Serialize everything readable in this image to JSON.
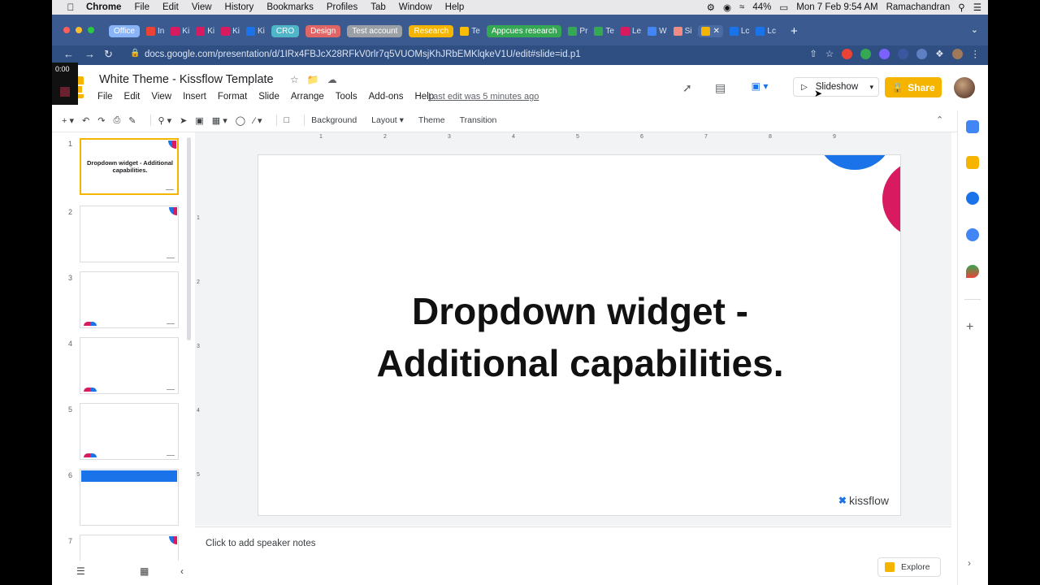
{
  "macos": {
    "app_name": "Chrome",
    "menu": [
      "File",
      "Edit",
      "View",
      "History",
      "Bookmarks",
      "Profiles",
      "Tab",
      "Window",
      "Help"
    ],
    "battery": "44%",
    "datetime": "Mon 7 Feb 9:54 AM",
    "user": "Ramachandran"
  },
  "tabs": {
    "groups": [
      {
        "label": "Office",
        "color": "#8ab4f8"
      },
      {
        "label": "CRO",
        "color": "#4fb6c9"
      },
      {
        "label": "Design",
        "color": "#e06666"
      },
      {
        "label": "Test account",
        "color": "#9aa0a6"
      },
      {
        "label": "Research",
        "color": "#f4b400"
      },
      {
        "label": "Appcues research",
        "color": "#34a853"
      }
    ],
    "items": [
      "In",
      "Ki",
      "Ki",
      "Ki",
      "Ki",
      "Ki",
      "Te",
      "Pr",
      "Te",
      "Le",
      "W",
      "Si",
      "Lc",
      "Lc",
      "Lc"
    ]
  },
  "address": {
    "url": "docs.google.com/presentation/d/1IRx4FBJcX28RFkV0rlr7q5VUOMsjKhJRbEMKlqkeV1U/edit#slide=id.p1"
  },
  "header": {
    "title": "White Theme - Kissflow Template",
    "menu": [
      "File",
      "Edit",
      "View",
      "Insert",
      "Format",
      "Slide",
      "Arrange",
      "Tools",
      "Add-ons",
      "Help"
    ],
    "last_edit": "Last edit was 5 minutes ago",
    "slideshow_label": "Slideshow",
    "share_label": "Share"
  },
  "toolbar": {
    "background": "Background",
    "layout": "Layout",
    "theme": "Theme",
    "transition": "Transition"
  },
  "filmstrip": {
    "slides": [
      {
        "number": "1",
        "title": "Dropdown widget - Additional capabilities."
      },
      {
        "number": "2",
        "title": ""
      },
      {
        "number": "3",
        "title": ""
      },
      {
        "number": "4",
        "title": ""
      },
      {
        "number": "5",
        "title": ""
      },
      {
        "number": "6",
        "title": ""
      },
      {
        "number": "7",
        "title": ""
      }
    ],
    "recording_time": "0:00"
  },
  "ruler": {
    "horizontal": [
      "1",
      "2",
      "3",
      "4",
      "5",
      "6",
      "7",
      "8",
      "9"
    ],
    "vertical": [
      "1",
      "2",
      "3",
      "4",
      "5"
    ]
  },
  "slide": {
    "title_line1": "Dropdown widget -",
    "title_line2": "Additional capabilities.",
    "brand": "kissflow"
  },
  "notes": {
    "placeholder": "Click to add speaker notes"
  },
  "explore": {
    "label": "Explore"
  },
  "colors": {
    "accent_yellow": "#f4b400",
    "brand_blue": "#1a73e8",
    "brand_pink": "#d81b60",
    "tabbar": "#3b5b90"
  }
}
